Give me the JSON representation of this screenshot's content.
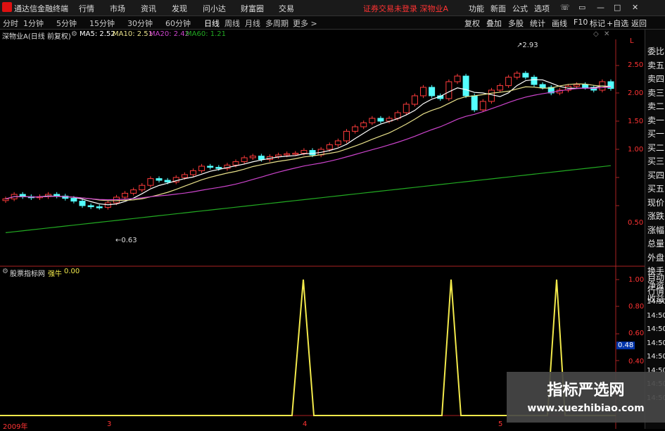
{
  "menubar": {
    "app_name": "通达信金融终端",
    "items": [
      "行情",
      "市场",
      "资讯",
      "发现",
      "问小达",
      "财富圈",
      "交易"
    ],
    "alert": "证券交易未登录  深物业A",
    "right_items": [
      "功能",
      "新面",
      "公式",
      "选项"
    ]
  },
  "toolbar": {
    "timeframes": [
      "分时",
      "1分钟",
      "5分钟",
      "15分钟",
      "30分钟",
      "60分钟",
      "日线",
      "周线",
      "月线",
      "多周期",
      "更多 >"
    ],
    "active_timeframe": "日线",
    "buttons": [
      "复权",
      "叠加",
      "多股",
      "统计",
      "画线",
      "F10",
      "标记",
      "+自选",
      "返回"
    ]
  },
  "main_chart": {
    "title": "深物业A(日线 前复权)",
    "ma5": "MA5: 2.52",
    "ma10": "MA10: 2.51",
    "ma20": "MA20: 2.42",
    "ma60": "MA60: 1.21",
    "high_label": "2.93",
    "low_label": "0.63",
    "y_axis": [
      "2.50",
      "2.00",
      "1.50",
      "1.00",
      "0.50"
    ],
    "colors": {
      "ma5": "#ffffff",
      "ma10": "#e8e08a",
      "ma20": "#cc44cc",
      "ma60": "#22aa22",
      "up": "#ff3b3b",
      "down": "#54ffff"
    }
  },
  "indicator": {
    "source": "股票指标网",
    "name": "强牛",
    "value": "0.00",
    "y_axis": [
      "1.00",
      "0.80",
      "0.60",
      "0.40"
    ],
    "cursor_value": "0.48",
    "color": "#f2e94b"
  },
  "x_axis": [
    "2009年",
    "3",
    "4",
    "5"
  ],
  "right_panel": {
    "top_label": "L",
    "items": [
      "委比",
      "卖五",
      "卖四",
      "卖三",
      "卖二",
      "卖一",
      "买一",
      "买二",
      "买三",
      "买四",
      "买五",
      "现价",
      "涨跌",
      "涨幅",
      "总量",
      "外盘",
      "换手",
      "净资",
      "收益"
    ],
    "lower_items": [
      "自动",
      "行情",
      "14:50",
      "14:50",
      "14:50",
      "14:50",
      "14:50",
      "14:50",
      "14:50",
      "14:50"
    ]
  },
  "watermark": {
    "line1": "指标严选网",
    "line2": "www.xuezhibiao.com"
  }
}
